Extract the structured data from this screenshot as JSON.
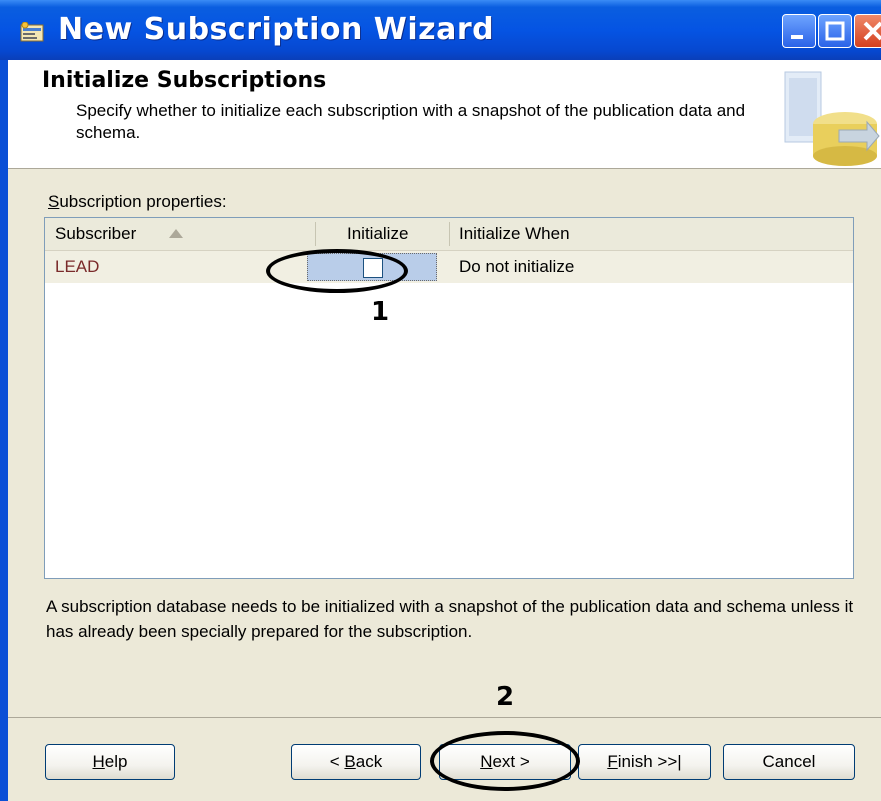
{
  "window": {
    "title": "New Subscription Wizard"
  },
  "header": {
    "title": "Initialize Subscriptions",
    "description": "Specify whether to initialize each subscription with a snapshot of the publication data and schema."
  },
  "grid": {
    "label": "Subscription properties:",
    "columns": [
      "Subscriber",
      "Initialize",
      "Initialize When"
    ],
    "rows": [
      {
        "subscriber": "LEAD",
        "initialize": false,
        "initialize_when": "Do not initialize"
      }
    ]
  },
  "note": "A subscription database needs to be initialized with a snapshot of the publication data and schema unless it has already been specially prepared for the subscription.",
  "annotations": {
    "one": "1",
    "two": "2"
  },
  "buttons": {
    "help": "Help",
    "back": "< Back",
    "next": "Next >",
    "finish": "Finish >>|",
    "cancel": "Cancel"
  },
  "colors": {
    "titlebar": "#0554e3",
    "selection": "#b9cde9",
    "subscriber_text": "#7a2a2a"
  }
}
